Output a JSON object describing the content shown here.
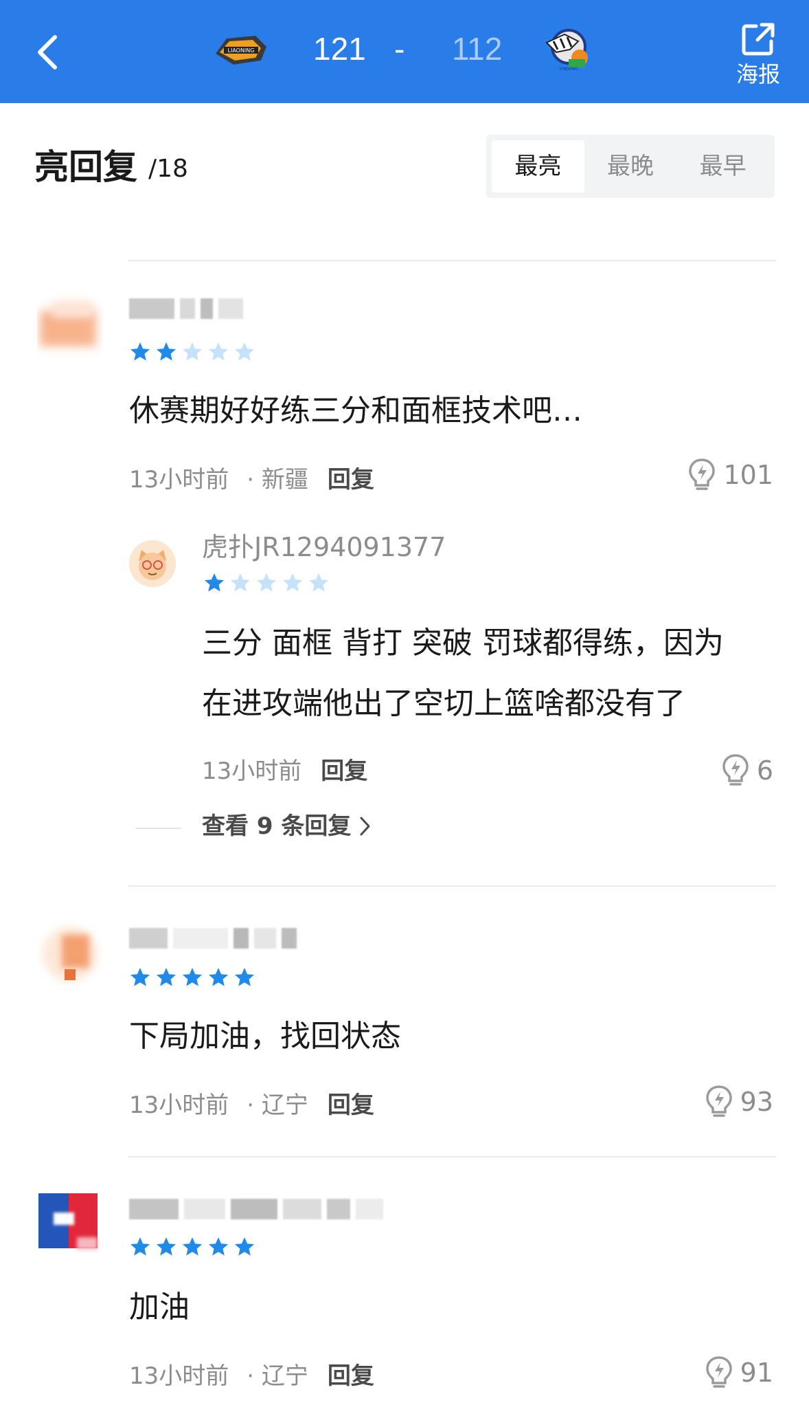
{
  "header": {
    "home_score": "121",
    "separator": "-",
    "away_score": "112",
    "poster_label": "海报",
    "home_logo_text": "LIAONING",
    "away_logo_text": "XINJIANG"
  },
  "section": {
    "title": "亮回复",
    "count": "/18",
    "sort_tabs": [
      "最亮",
      "最晚",
      "最早"
    ]
  },
  "comments": [
    {
      "rating": 2,
      "text": "休赛期好好练三分和面框技术吧…",
      "time": "13小时前",
      "location": "· 新疆",
      "reply_label": "回复",
      "likes": "101",
      "reply": {
        "username": "虎扑JR1294091377",
        "rating": 1,
        "text_line1": "三分 面框 背打 突破 罚球都得练，因为",
        "text_line2": "在进攻端他出了空切上篮啥都没有了",
        "time": "13小时前",
        "reply_label": "回复",
        "likes": "6"
      },
      "view_more": "查看 9 条回复"
    },
    {
      "rating": 5,
      "text": "下局加油，找回状态",
      "time": "13小时前",
      "location": "· 辽宁",
      "reply_label": "回复",
      "likes": "93"
    },
    {
      "rating": 5,
      "text": "加油",
      "time": "13小时前",
      "location": "· 辽宁",
      "reply_label": "回复",
      "likes": "91"
    }
  ],
  "colors": {
    "header_bg": "#2a7ce9",
    "star_on": "#1f8ae8",
    "star_off": "#c6e2fa",
    "muted_text": "#8c8c8c"
  }
}
